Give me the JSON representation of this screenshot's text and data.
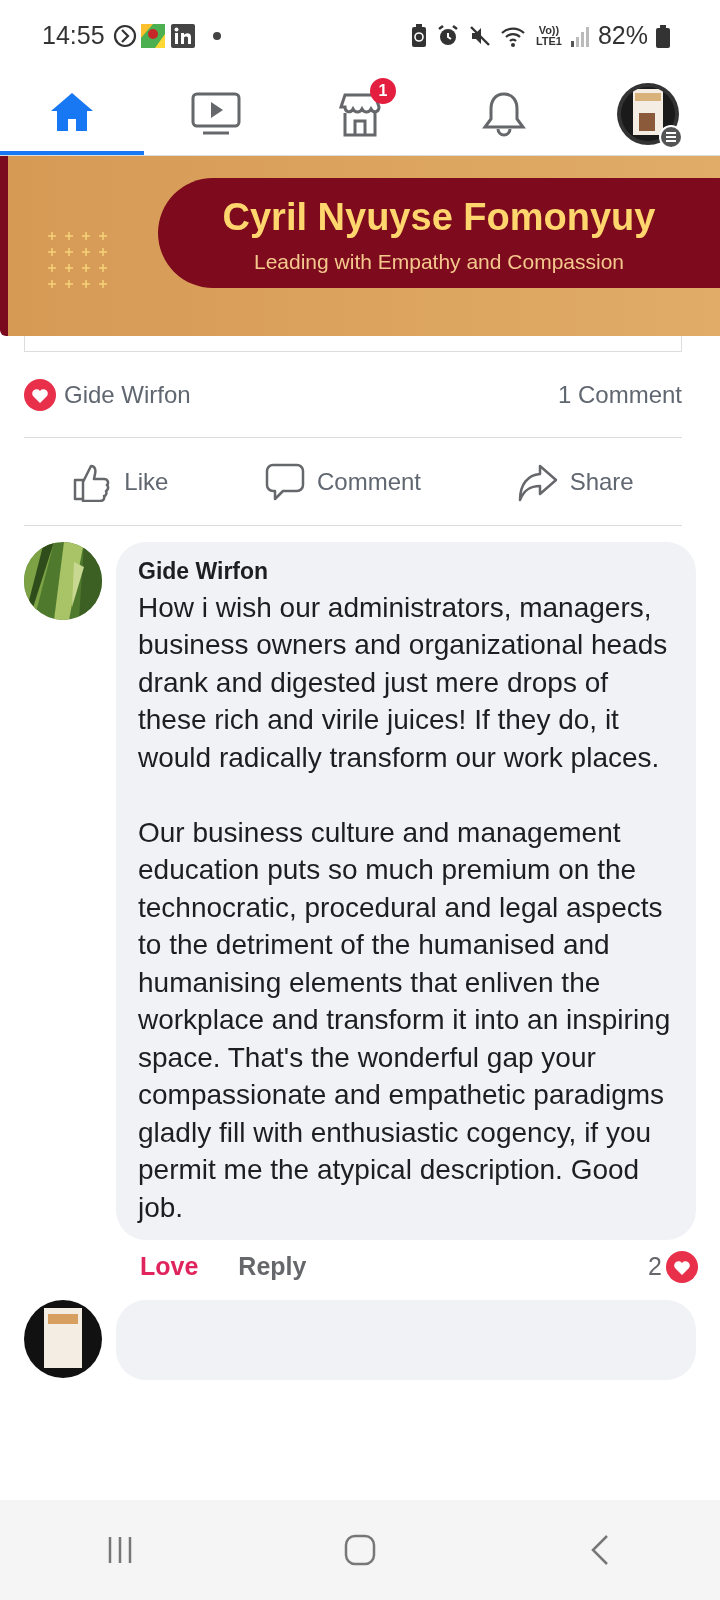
{
  "status_bar": {
    "time": "14:55",
    "network_top": "Vo))",
    "network_bottom": "LTE1",
    "battery": "82%"
  },
  "nav_tabs": [
    {
      "kind": "home",
      "selected": true
    },
    {
      "kind": "video",
      "selected": false
    },
    {
      "kind": "marketplace",
      "selected": false,
      "badge": "1"
    },
    {
      "kind": "notifications",
      "selected": false
    },
    {
      "kind": "profile",
      "selected": false
    }
  ],
  "banner": {
    "title": "Cyril Nyuyse Fomonyuy",
    "subtitle": "Leading with Empathy and Compassion"
  },
  "reactions": {
    "names": "Gide Wirfon",
    "comments": "1 Comment"
  },
  "actions": [
    {
      "kind": "like",
      "label": "Like"
    },
    {
      "kind": "comment",
      "label": "Comment"
    },
    {
      "kind": "share",
      "label": "Share"
    }
  ],
  "comment": {
    "author": "Gide Wirfon",
    "paragraphs": [
      "How i wish our administrators, managers,  business owners and organizational heads drank and digested just mere drops of these rich and virile juices! If they do, it would radically transform our work places.",
      "Our business culture and management education puts so much premium on the technocratic, procedural and legal aspects to the detriment of the humanised and humanising elements that enliven the workplace and transform it into an inspiring space. That's the wonderful gap your compassionate and empathetic paradigms gladly fill with enthusiastic cogency, if you permit me the atypical description. Good job."
    ],
    "loved": true,
    "love_label": "Love",
    "reply_label": "Reply",
    "reaction_count": "2"
  }
}
